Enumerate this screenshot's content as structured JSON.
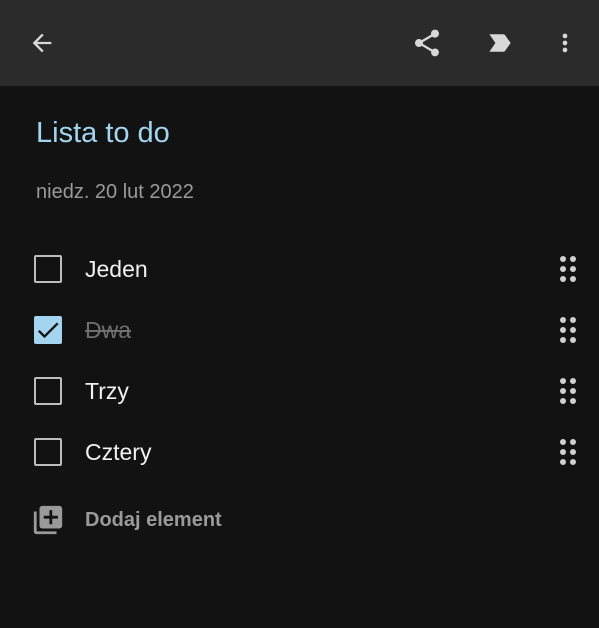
{
  "note": {
    "title": "Lista to do",
    "date": "niedz. 20 lut 2022"
  },
  "items": [
    {
      "label": "Jeden",
      "checked": false
    },
    {
      "label": "Dwa",
      "checked": true
    },
    {
      "label": "Trzy",
      "checked": false
    },
    {
      "label": "Cztery",
      "checked": false
    }
  ],
  "add_item_label": "Dodaj element",
  "toolbar": {
    "icons": [
      "back-arrow-icon",
      "share-icon",
      "label-icon",
      "more-vert-icon"
    ]
  },
  "colors": {
    "background": "#121212",
    "toolbar": "#2b2b2b",
    "accent": "#a3d4f0",
    "text": "#f1f1f1",
    "muted": "#9a9a9a"
  }
}
